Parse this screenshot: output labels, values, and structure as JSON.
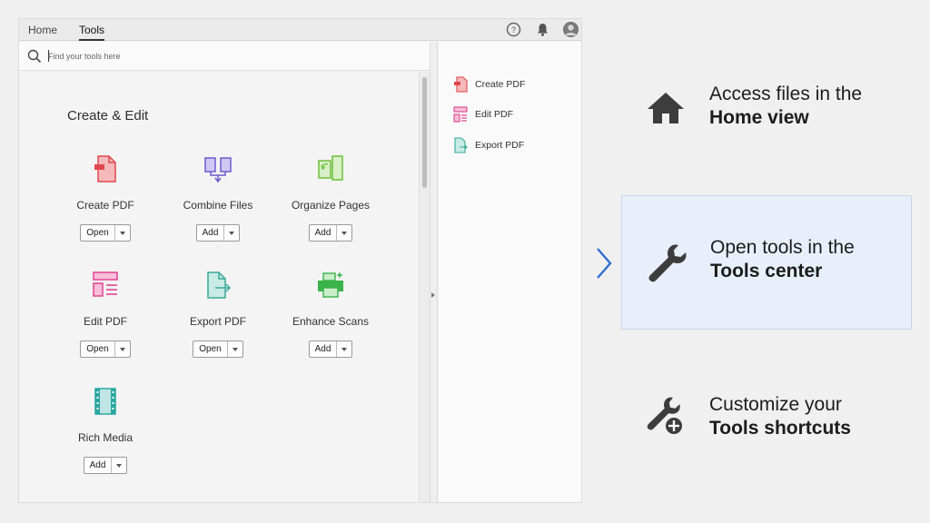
{
  "tabs": {
    "home": "Home",
    "tools": "Tools"
  },
  "search": {
    "placeholder": "Find your tools here"
  },
  "section": {
    "title": "Create & Edit"
  },
  "tools": [
    {
      "label": "Create PDF",
      "button": "Open"
    },
    {
      "label": "Combine Files",
      "button": "Add"
    },
    {
      "label": "Organize Pages",
      "button": "Add"
    },
    {
      "label": "Edit PDF",
      "button": "Open"
    },
    {
      "label": "Export PDF",
      "button": "Open"
    },
    {
      "label": "Enhance Scans",
      "button": "Add"
    },
    {
      "label": "Rich Media",
      "button": "Add"
    }
  ],
  "shortcuts": [
    {
      "label": "Create PDF"
    },
    {
      "label": "Edit PDF"
    },
    {
      "label": "Export PDF"
    }
  ],
  "features": [
    {
      "line1": "Access files in the",
      "line2": "Home view",
      "icon": "home-icon"
    },
    {
      "line1": "Open tools in the",
      "line2": "Tools center",
      "icon": "wrench-icon"
    },
    {
      "line1": "Customize your",
      "line2": "Tools shortcuts",
      "icon": "wrench-plus-icon"
    }
  ],
  "colors": {
    "accent_blue": "#2f6fd1",
    "create_pdf": "#e0474c",
    "combine": "#6d5bd0",
    "organize": "#6cbf3a",
    "edit": "#e0448f",
    "export": "#3aa89a",
    "enhance": "#3bb34a",
    "rich_media": "#2aa6a0"
  }
}
